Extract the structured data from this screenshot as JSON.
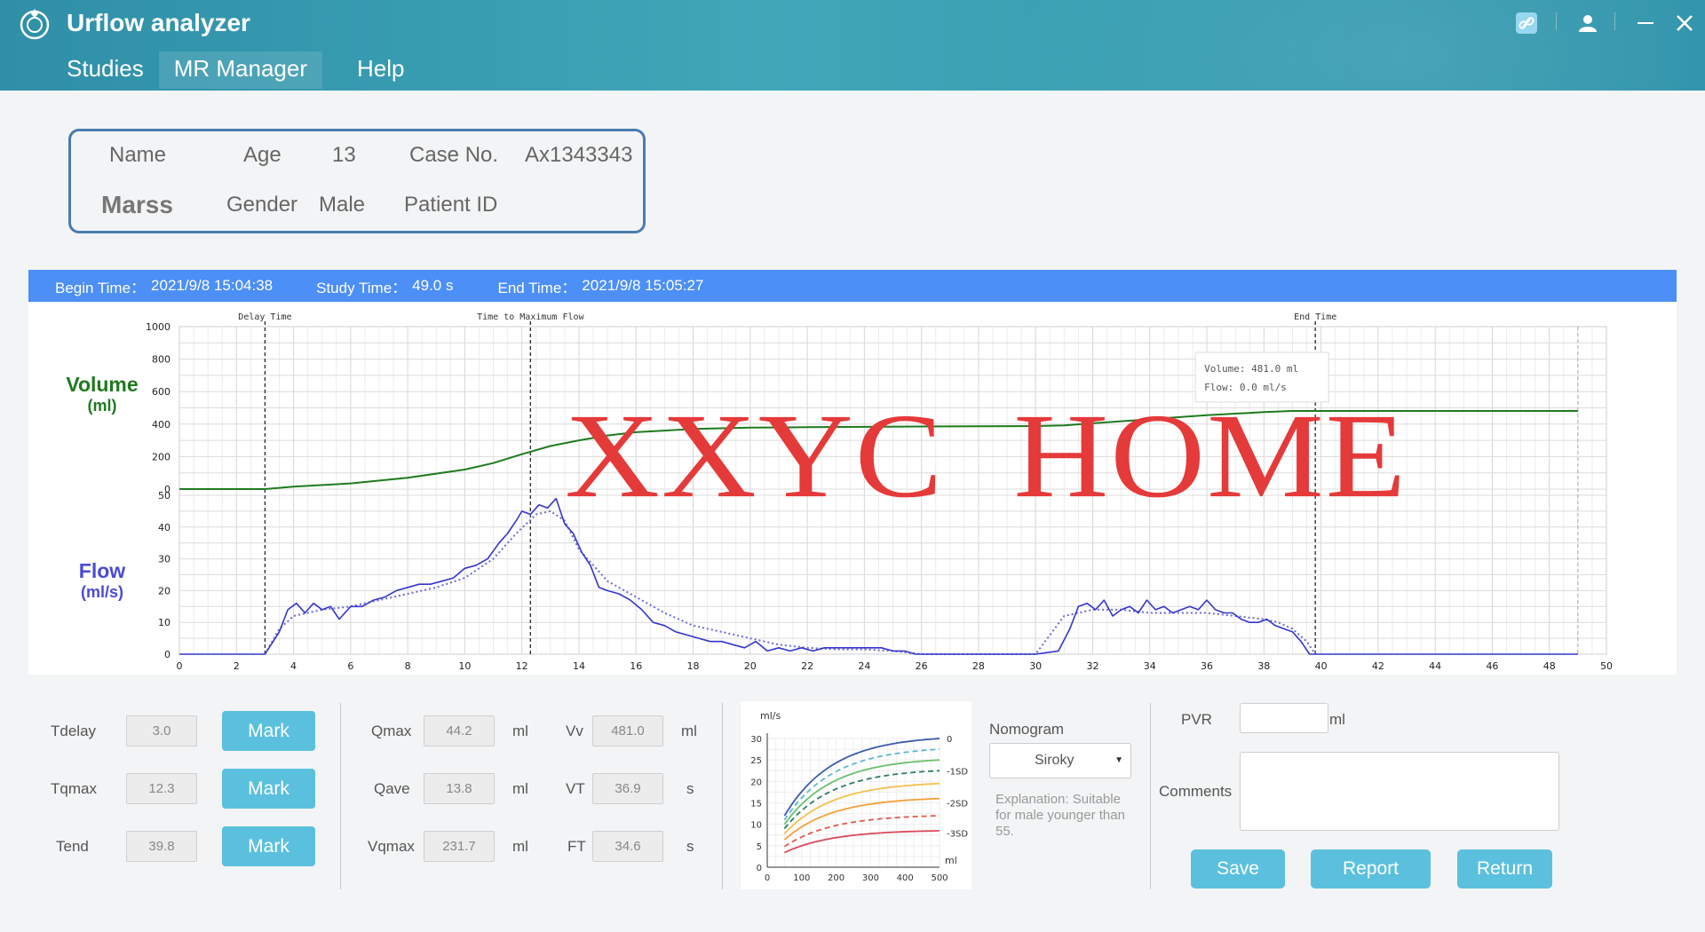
{
  "app": {
    "title": "Urflow analyzer"
  },
  "menu": {
    "items": [
      {
        "label": "Studies"
      },
      {
        "label": "MR Manager"
      },
      {
        "label": "Help"
      }
    ]
  },
  "window_controls": {
    "link_icon": "link-icon",
    "user_icon": "user-icon",
    "minimize": "–",
    "close": "✕"
  },
  "patient": {
    "name_label": "Name",
    "name_value": "Marss",
    "age_label": "Age",
    "age_value": "13",
    "gender_label": "Gender",
    "gender_value": "Male",
    "case_label": "Case No.",
    "case_value": "Ax1343343",
    "patient_id_label": "Patient ID"
  },
  "study": {
    "begin_label": "Begin Time：",
    "begin_value": "2021/9/8 15:04:38",
    "study_label": "Study Time：",
    "study_value": "49.0 s",
    "end_label": "End Time：",
    "end_value": "2021/9/8 15:05:27"
  },
  "watermark": "XXYC  HOME",
  "chart_data": {
    "type": "line",
    "x_ticks": [
      0,
      2,
      4,
      6,
      8,
      10,
      12,
      14,
      16,
      18,
      20,
      22,
      24,
      26,
      28,
      30,
      32,
      34,
      36,
      38,
      40,
      42,
      44,
      46,
      48,
      50
    ],
    "volume": {
      "label": "Volume",
      "unit": "(ml)",
      "color": "#1f7a1f",
      "ylim": [
        0,
        1000
      ],
      "ticks": [
        0,
        200,
        400,
        600,
        800,
        1000
      ],
      "x": [
        0,
        3,
        4,
        6,
        8,
        10,
        11,
        12,
        13,
        14,
        15,
        16,
        17,
        18,
        20,
        22,
        24,
        26,
        28,
        30,
        31,
        32,
        34,
        36,
        38,
        39,
        40,
        44,
        48,
        49
      ],
      "y": [
        0,
        0,
        15,
        35,
        70,
        120,
        160,
        215,
        265,
        300,
        330,
        350,
        360,
        370,
        378,
        381,
        383,
        385,
        387,
        388,
        392,
        405,
        430,
        455,
        474,
        481,
        481,
        481,
        481,
        481
      ]
    },
    "flow": {
      "label": "Flow",
      "unit": "(ml/s)",
      "color": "#3535cc",
      "ylim": [
        0,
        50
      ],
      "ticks": [
        0,
        10,
        20,
        30,
        40,
        50
      ],
      "x": [
        0,
        3.0,
        3.5,
        3.8,
        4.1,
        4.4,
        4.7,
        5.0,
        5.3,
        5.6,
        6.0,
        6.4,
        6.8,
        7.2,
        7.6,
        8.0,
        8.4,
        8.8,
        9.2,
        9.6,
        10.0,
        10.4,
        10.8,
        11.2,
        11.5,
        11.8,
        12.0,
        12.3,
        12.6,
        12.9,
        13.2,
        13.5,
        13.8,
        14.1,
        14.4,
        14.7,
        15.0,
        15.4,
        15.8,
        16.2,
        16.6,
        17.0,
        17.4,
        17.8,
        18.2,
        18.6,
        19.0,
        19.4,
        19.8,
        20.2,
        20.6,
        21.0,
        21.4,
        21.8,
        22.2,
        22.6,
        23.0,
        23.4,
        23.8,
        24.2,
        24.6,
        25.0,
        25.4,
        25.8,
        26.2,
        27,
        28,
        29,
        30,
        30.8,
        31.2,
        31.5,
        31.8,
        32.1,
        32.4,
        32.7,
        33.0,
        33.3,
        33.6,
        33.9,
        34.2,
        34.5,
        34.8,
        35.1,
        35.4,
        35.7,
        36.0,
        36.3,
        36.6,
        36.9,
        37.2,
        37.5,
        37.8,
        38.1,
        38.4,
        38.7,
        39.0,
        39.3,
        39.6,
        39.8,
        40.5,
        44,
        48,
        49
      ],
      "y": [
        0,
        0,
        7,
        14,
        16,
        13,
        16,
        14,
        15,
        11,
        15,
        15,
        17,
        18,
        20,
        21,
        22,
        22,
        23,
        24,
        27,
        28,
        30,
        35,
        38,
        42,
        45,
        44,
        47,
        46,
        49,
        41,
        38,
        32,
        28,
        21,
        20,
        19,
        17,
        14,
        10,
        9,
        7,
        6,
        5,
        4,
        4,
        3,
        2,
        4,
        1,
        2,
        1,
        2,
        1,
        2,
        2,
        2,
        2,
        2,
        2,
        1,
        1,
        0,
        0,
        0,
        0,
        0,
        0,
        1,
        8,
        15,
        16,
        14,
        17,
        12,
        14,
        15,
        13,
        17,
        14,
        15,
        13,
        14,
        15,
        14,
        17,
        14,
        13,
        13,
        11,
        10,
        10,
        11,
        9,
        8,
        7,
        4,
        0,
        0,
        0,
        0,
        0,
        0
      ]
    },
    "flow_smooth": {
      "x": [
        3,
        3.5,
        4,
        5,
        6,
        7,
        8,
        9,
        10,
        11,
        11.8,
        12.5,
        13,
        13.5,
        14,
        15,
        16,
        17,
        18,
        19,
        20,
        21,
        22,
        23,
        24,
        25,
        26,
        30,
        31,
        32,
        33,
        34,
        35,
        36,
        37,
        38,
        38.5,
        39,
        39.5,
        39.8
      ],
      "y": [
        0,
        8,
        12,
        14,
        15,
        17,
        19,
        21,
        24,
        30,
        38,
        44,
        45,
        42,
        33,
        23,
        18,
        13,
        9,
        7,
        5,
        3,
        2,
        1.5,
        1.5,
        1,
        0,
        0,
        12,
        14,
        14,
        13,
        13,
        13,
        12,
        11,
        10,
        8,
        4,
        0
      ]
    },
    "annotations": [
      {
        "label": "Delay Time",
        "x": 3.0
      },
      {
        "label": "Time to Maximum Flow",
        "x": 12.3
      },
      {
        "label": "End Time",
        "x": 39.8
      }
    ],
    "end_marker_x": 49,
    "tooltip": {
      "volume": "Volume: 481.0 ml",
      "flow": "Flow: 0.0 ml/s"
    }
  },
  "controls": {
    "tdelay_label": "Tdelay",
    "tdelay_value": "3.0",
    "tqmax_label": "Tqmax",
    "tqmax_value": "12.3",
    "tend_label": "Tend",
    "tend_value": "39.8",
    "mark_label": "Mark",
    "qmax_label": "Qmax",
    "qmax_value": "44.2",
    "qmax_unit": "ml",
    "qave_label": "Qave",
    "qave_value": "13.8",
    "qave_unit": "ml",
    "vqmax_label": "Vqmax",
    "vqmax_value": "231.7",
    "vqmax_unit": "ml",
    "vv_label": "Vv",
    "vv_value": "481.0",
    "vv_unit": "ml",
    "vt_label": "VT",
    "vt_value": "36.9",
    "vt_unit": "s",
    "ft_label": "FT",
    "ft_value": "34.6",
    "ft_unit": "s"
  },
  "nomogram": {
    "title": "Nomogram",
    "selected": "Siroky",
    "explanation": "Explanation: Suitable for male younger than 55.",
    "y_unit": "ml/s",
    "x_unit": "ml",
    "x_ticks": [
      0,
      100,
      200,
      300,
      400,
      500
    ],
    "y_ticks": [
      0,
      5,
      10,
      15,
      20,
      25,
      30
    ],
    "line_labels": [
      "0",
      "-1SD",
      "-2SD",
      "-3SD"
    ],
    "curves": [
      {
        "color": "#3b5bab",
        "dash": false,
        "end": 30
      },
      {
        "color": "#5fb7d4",
        "dash": true,
        "end": 27.5
      },
      {
        "color": "#6cbf6c",
        "dash": false,
        "end": 25
      },
      {
        "color": "#2e7d6a",
        "dash": true,
        "end": 22.5
      },
      {
        "color": "#f2c14e",
        "dash": false,
        "end": 19.5
      },
      {
        "color": "#f4a03a",
        "dash": false,
        "end": 16
      },
      {
        "color": "#e05a4e",
        "dash": true,
        "end": 12
      },
      {
        "color": "#d94a5a",
        "dash": false,
        "end": 8.5
      }
    ]
  },
  "right_panel": {
    "pvr_label": "PVR",
    "pvr_unit": "ml",
    "comments_label": "Comments",
    "save_label": "Save",
    "report_label": "Report",
    "return_label": "Return"
  }
}
